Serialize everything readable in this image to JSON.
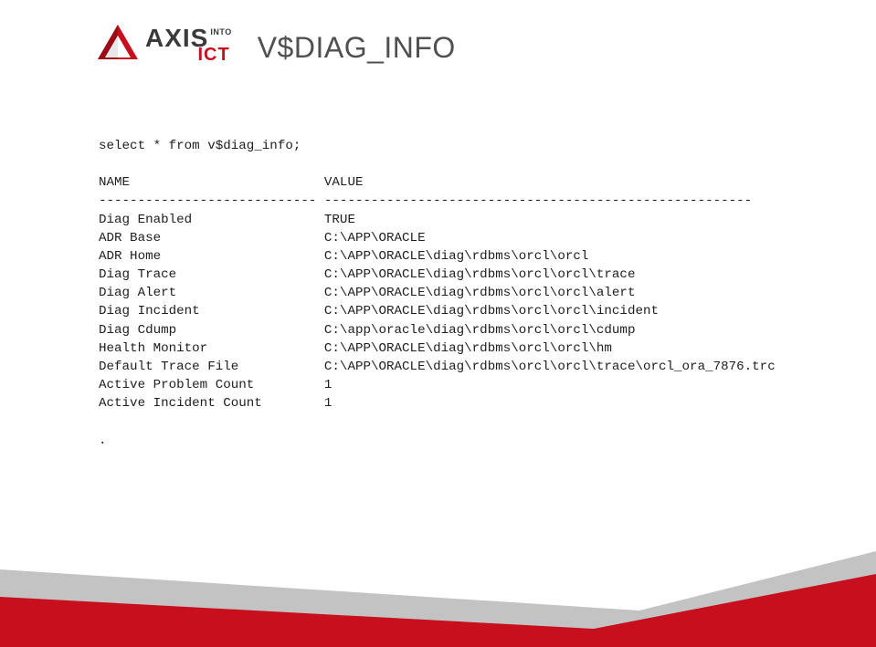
{
  "logo": {
    "axis": "AXIS",
    "into": "INTO",
    "ict": "ICT"
  },
  "title": "V$DIAG_INFO",
  "query": "select * from v$diag_info;",
  "col1_header": "NAME",
  "col2_header": "VALUE",
  "col1_divider": "----------------------------",
  "col2_divider": "-------------------------------------------------------",
  "rows": [
    {
      "name": "Diag Enabled",
      "value": "TRUE"
    },
    {
      "name": "ADR Base",
      "value": "C:\\APP\\ORACLE"
    },
    {
      "name": "ADR Home",
      "value": "C:\\APP\\ORACLE\\diag\\rdbms\\orcl\\orcl"
    },
    {
      "name": "Diag Trace",
      "value": "C:\\APP\\ORACLE\\diag\\rdbms\\orcl\\orcl\\trace"
    },
    {
      "name": "Diag Alert",
      "value": "C:\\APP\\ORACLE\\diag\\rdbms\\orcl\\orcl\\alert"
    },
    {
      "name": "Diag Incident",
      "value": "C:\\APP\\ORACLE\\diag\\rdbms\\orcl\\orcl\\incident"
    },
    {
      "name": "Diag Cdump",
      "value": "C:\\app\\oracle\\diag\\rdbms\\orcl\\orcl\\cdump"
    },
    {
      "name": "Health Monitor",
      "value": "C:\\APP\\ORACLE\\diag\\rdbms\\orcl\\orcl\\hm"
    },
    {
      "name": "Default Trace File",
      "value": "C:\\APP\\ORACLE\\diag\\rdbms\\orcl\\orcl\\trace\\orcl_ora_7876.trc"
    },
    {
      "name": "Active Problem Count",
      "value": "1"
    },
    {
      "name": "Active Incident Count",
      "value": "1"
    }
  ],
  "terminator": "."
}
